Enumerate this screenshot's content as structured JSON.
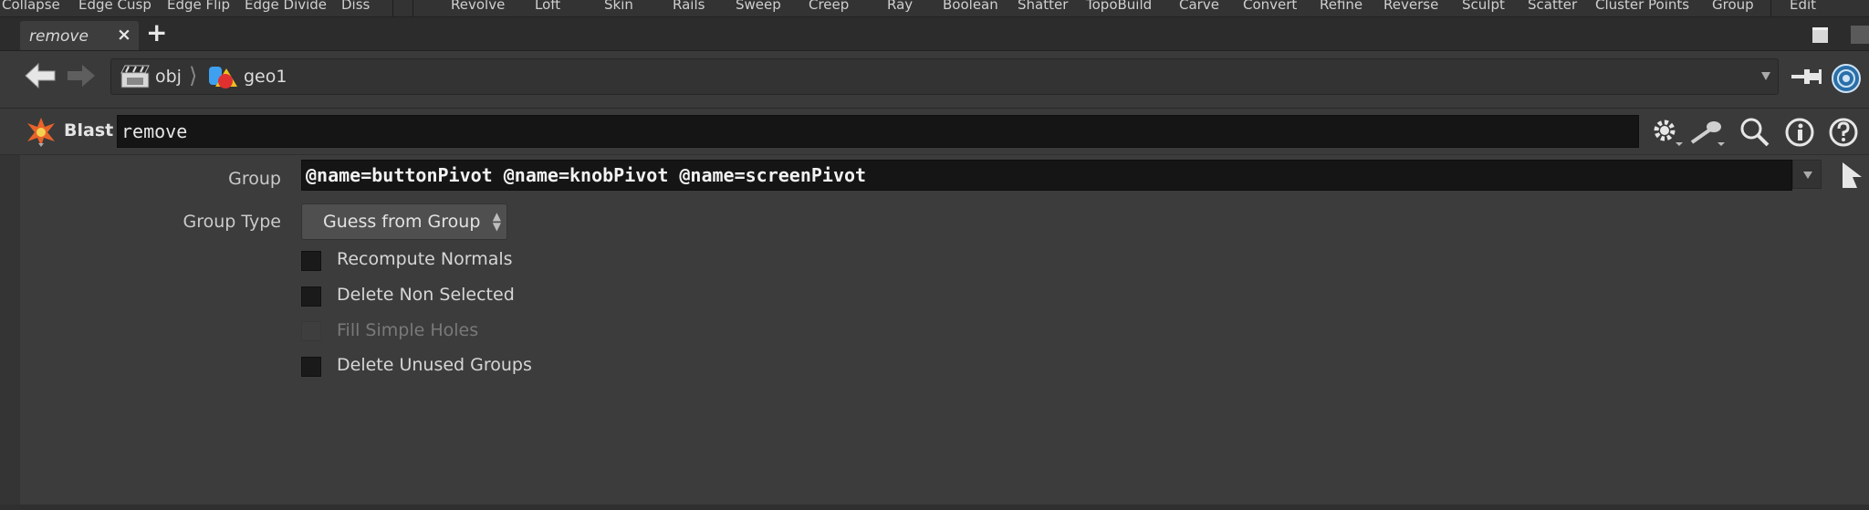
{
  "shelf": {
    "items": [
      "Collapse",
      "Edge Cusp",
      "Edge Flip",
      "Edge Divide",
      "Diss",
      "Revolve",
      "Loft",
      "Skin",
      "Rails",
      "Sweep",
      "Creep",
      "Ray",
      "Boolean",
      "Shatter",
      "TopoBuild",
      "Carve",
      "Convert",
      "Refine",
      "Reverse",
      "Sculpt",
      "Scatter",
      "Cluster Points",
      "Group",
      "Edit"
    ]
  },
  "tabs": {
    "active_label": "remove",
    "close_glyph": "×",
    "add_glyph": "+"
  },
  "path": {
    "segments": [
      {
        "label": "obj",
        "icon": "obj-network-icon"
      },
      {
        "label": "geo1",
        "icon": "geo-object-icon"
      }
    ],
    "separator": "⟩"
  },
  "node": {
    "type_label": "Blast",
    "name": "remove",
    "header_icons": [
      "gear-icon",
      "wrench-icon",
      "search-icon",
      "info-icon",
      "help-icon"
    ]
  },
  "params": {
    "group": {
      "label": "Group",
      "value": "@name=buttonPivot @name=knobPivot @name=screenPivot"
    },
    "group_type": {
      "label": "Group Type",
      "value": "Guess from Group"
    },
    "checkboxes": [
      {
        "label": "Recompute Normals",
        "checked": false,
        "enabled": true
      },
      {
        "label": "Delete Non Selected",
        "checked": false,
        "enabled": true
      },
      {
        "label": "Fill Simple Holes",
        "checked": false,
        "enabled": false
      },
      {
        "label": "Delete Unused Groups",
        "checked": false,
        "enabled": true
      }
    ]
  },
  "colors": {
    "background": "#3c3c3c",
    "field_background": "#151515",
    "text": "#cfcfcf",
    "disabled_text": "#797979"
  }
}
